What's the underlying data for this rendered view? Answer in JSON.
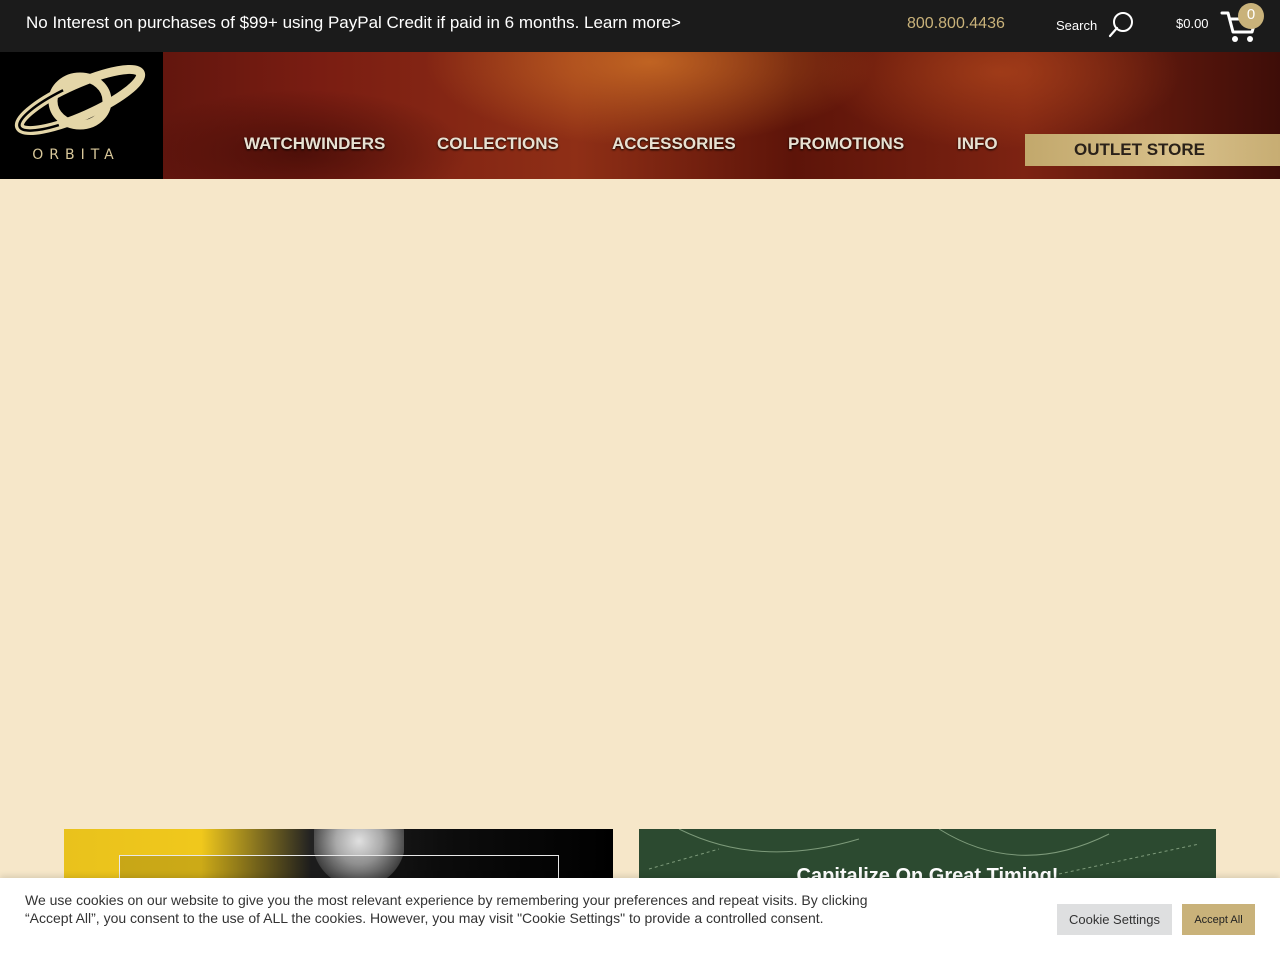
{
  "topbar": {
    "promo_text": "No Interest on purchases of $99+ using PayPal Credit if paid in 6 months. Learn more>",
    "phone": "800.800.4436",
    "search_label": "Search",
    "search_icon": "search-icon",
    "cart_total": "$0.00",
    "cart_icon": "cart-icon",
    "cart_count": "0"
  },
  "header": {
    "logo_text": "ORBITA",
    "nav": [
      {
        "label": "WATCHWINDERS"
      },
      {
        "label": "COLLECTIONS"
      },
      {
        "label": "ACCESSORIES"
      },
      {
        "label": "PROMOTIONS"
      },
      {
        "label": "INFO"
      }
    ],
    "outlet_label": "OUTLET STORE"
  },
  "promos": {
    "right_title": "Capitalize On Great Timing!"
  },
  "cookie": {
    "text": "We use cookies on our website to give you the most relevant experience by remembering your preferences and repeat visits. By clicking “Accept All”, you consent to the use of ALL the cookies. However, you may visit \"Cookie Settings\" to provide a controlled consent.",
    "settings_label": "Cookie Settings",
    "accept_label": "Accept All"
  },
  "colors": {
    "topbar_bg": "#1b1b1b",
    "accent_gold": "#c9b27a",
    "page_bg": "#f6e7c9",
    "header_leather": "#7a1d12"
  }
}
